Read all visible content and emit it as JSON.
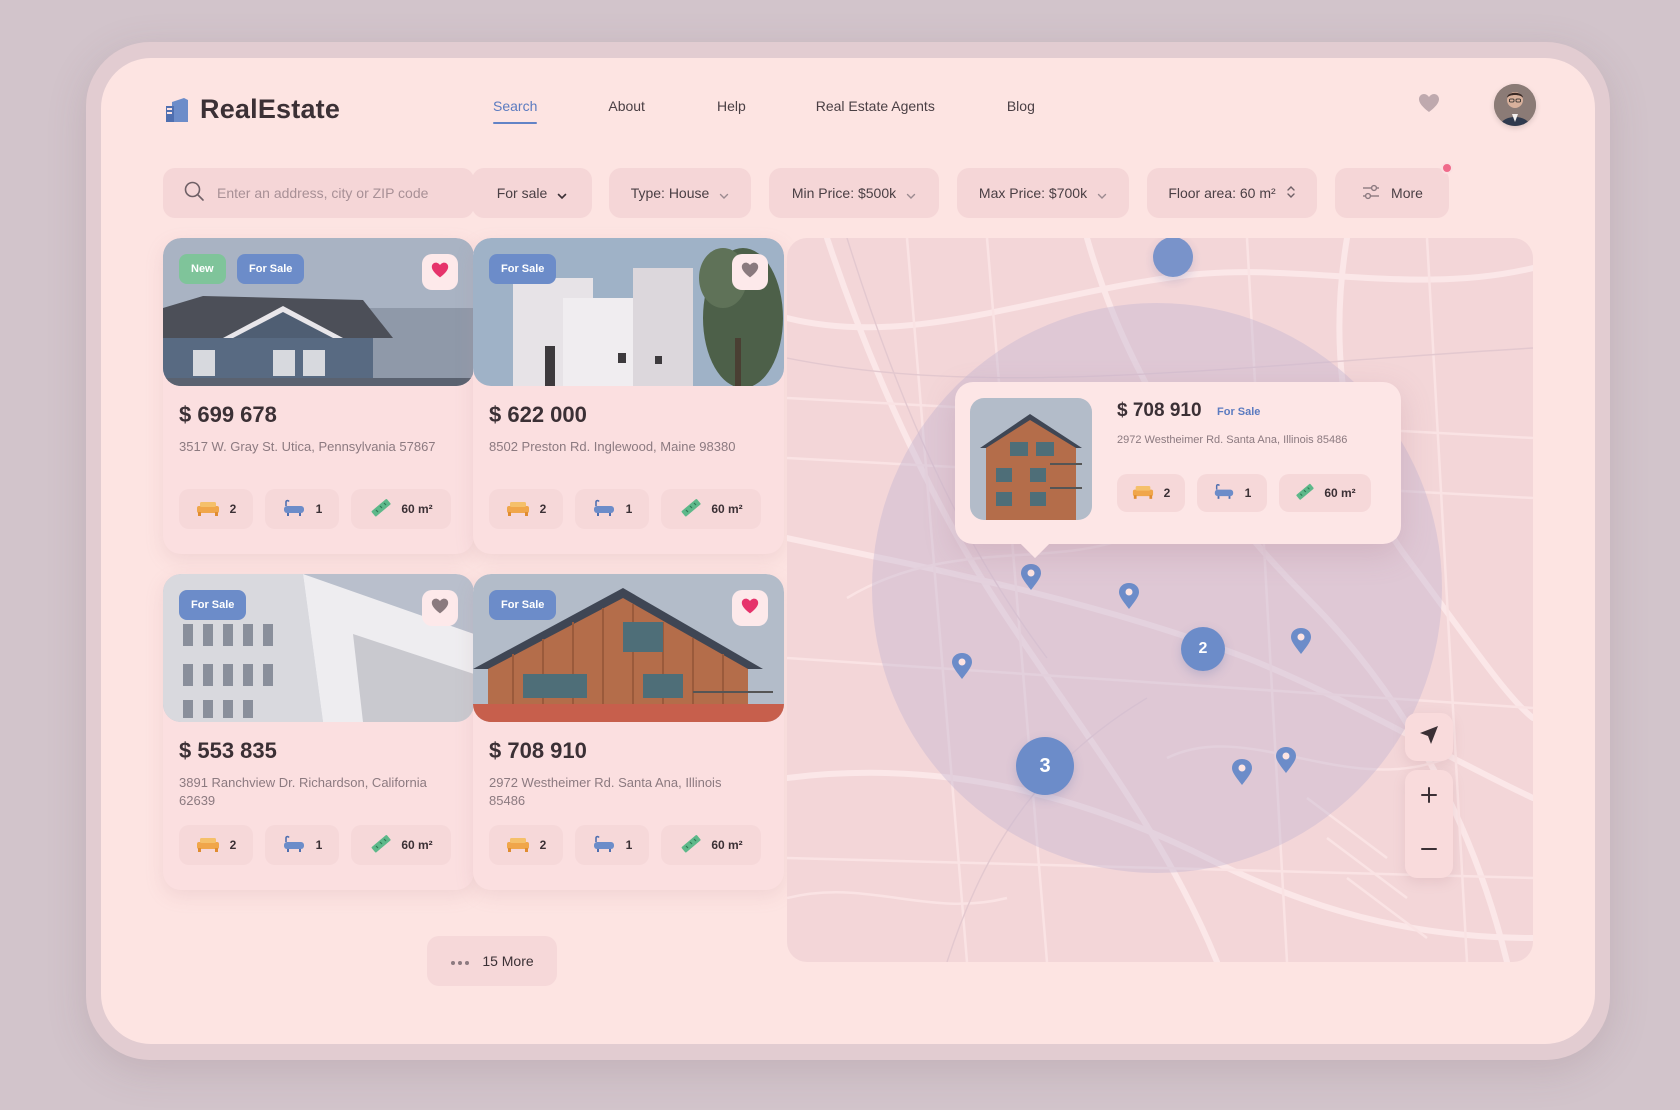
{
  "app": {
    "title": "RealEstate"
  },
  "nav": [
    {
      "label": "Search",
      "active": true
    },
    {
      "label": "About",
      "active": false
    },
    {
      "label": "Help",
      "active": false
    },
    {
      "label": "Real Estate Agents",
      "active": false
    },
    {
      "label": "Blog",
      "active": false
    }
  ],
  "search": {
    "placeholder": "Enter an address, city or ZIP code",
    "value": ""
  },
  "filters": {
    "listing": "For sale",
    "type": "Type: House",
    "min_price": "Min Price: $500k",
    "max_price": "Max Price: $700k",
    "floor_area": "Floor area: 60 m²",
    "more": "More"
  },
  "listings": [
    {
      "price": "$ 699 678",
      "address": "3517 W. Gray St. Utica, Pennsylvania 57867",
      "badges": [
        "New",
        "For Sale"
      ],
      "favorite": true,
      "beds": "2",
      "baths": "1",
      "area": "60 m²"
    },
    {
      "price": "$ 622 000",
      "address": "8502 Preston Rd. Inglewood, Maine 98380",
      "badges": [
        "For Sale"
      ],
      "favorite": false,
      "beds": "2",
      "baths": "1",
      "area": "60 m²"
    },
    {
      "price": "$ 553 835",
      "address": "3891 Ranchview Dr. Richardson, California 62639",
      "badges": [
        "For Sale"
      ],
      "favorite": false,
      "beds": "2",
      "baths": "1",
      "area": "60 m²"
    },
    {
      "price": "$ 708 910",
      "address": "2972 Westheimer Rd. Santa Ana, Illinois 85486",
      "badges": [
        "For Sale"
      ],
      "favorite": true,
      "beds": "2",
      "baths": "1",
      "area": "60 m²"
    }
  ],
  "more_button": {
    "label": "15 More"
  },
  "map": {
    "popup": {
      "price": "$ 708 910",
      "badge": "For Sale",
      "address": "2972 Westheimer Rd. Santa Ana, Illinois 85486",
      "beds": "2",
      "baths": "1",
      "area": "60 m²"
    },
    "clusters": [
      "2",
      "3"
    ]
  },
  "colors": {
    "accent": "#6c8cc9",
    "new_badge": "#7fc49a",
    "favorite": "#e6336b",
    "background": "#fde4e2"
  },
  "icons": [
    "logo-icon",
    "heart-icon",
    "avatar",
    "search-icon",
    "chevron-down-icon",
    "sort-icon",
    "filter-sliders-icon",
    "bed-icon",
    "bath-icon",
    "ruler-icon",
    "dots-icon",
    "map-pin-icon",
    "navigate-icon",
    "plus-icon",
    "minus-icon"
  ]
}
